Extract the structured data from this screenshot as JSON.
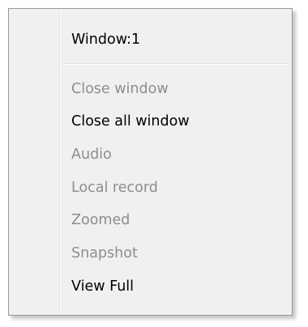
{
  "menu": {
    "header": {
      "label": "Window:1",
      "enabled": true
    },
    "items": [
      {
        "label": "Close window",
        "enabled": false
      },
      {
        "label": "Close all window",
        "enabled": true
      },
      {
        "label": "Audio",
        "enabled": false
      },
      {
        "label": "Local record",
        "enabled": false
      },
      {
        "label": "Zoomed",
        "enabled": false
      },
      {
        "label": "Snapshot",
        "enabled": false
      },
      {
        "label": "View Full",
        "enabled": true
      }
    ]
  },
  "colors": {
    "enabled_text": "#000000",
    "disabled_text": "#8d8d8d",
    "menu_background": "#f0f0f0",
    "menu_border": "#979797"
  }
}
